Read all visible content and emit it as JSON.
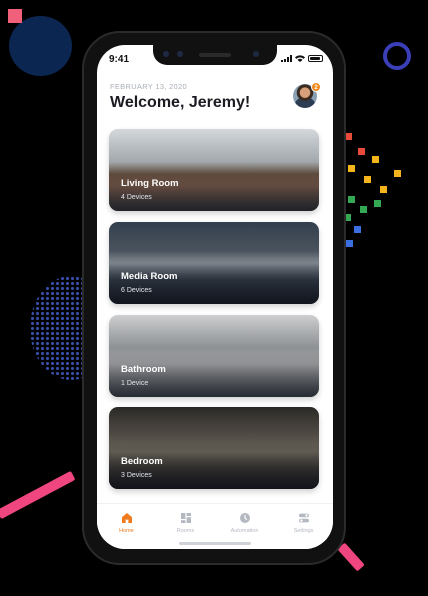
{
  "status": {
    "time": "9:41"
  },
  "header": {
    "date": "FEBRUARY 13, 2020",
    "welcome": "Welcome, Jeremy!",
    "notification_count": "2"
  },
  "rooms": [
    {
      "name": "Living Room",
      "devices": "4 Devices"
    },
    {
      "name": "Media Room",
      "devices": "6 Devices"
    },
    {
      "name": "Bathroom",
      "devices": "1 Device"
    },
    {
      "name": "Bedroom",
      "devices": "3 Devices"
    }
  ],
  "tabs": [
    {
      "label": "Home",
      "icon": "home-icon"
    },
    {
      "label": "Rooms",
      "icon": "grid-icon"
    },
    {
      "label": "Automation",
      "icon": "clock-icon"
    },
    {
      "label": "Settings",
      "icon": "toggles-icon"
    }
  ],
  "colors": {
    "accent": "#f07a1c",
    "inactive": "#b4b8c0"
  }
}
